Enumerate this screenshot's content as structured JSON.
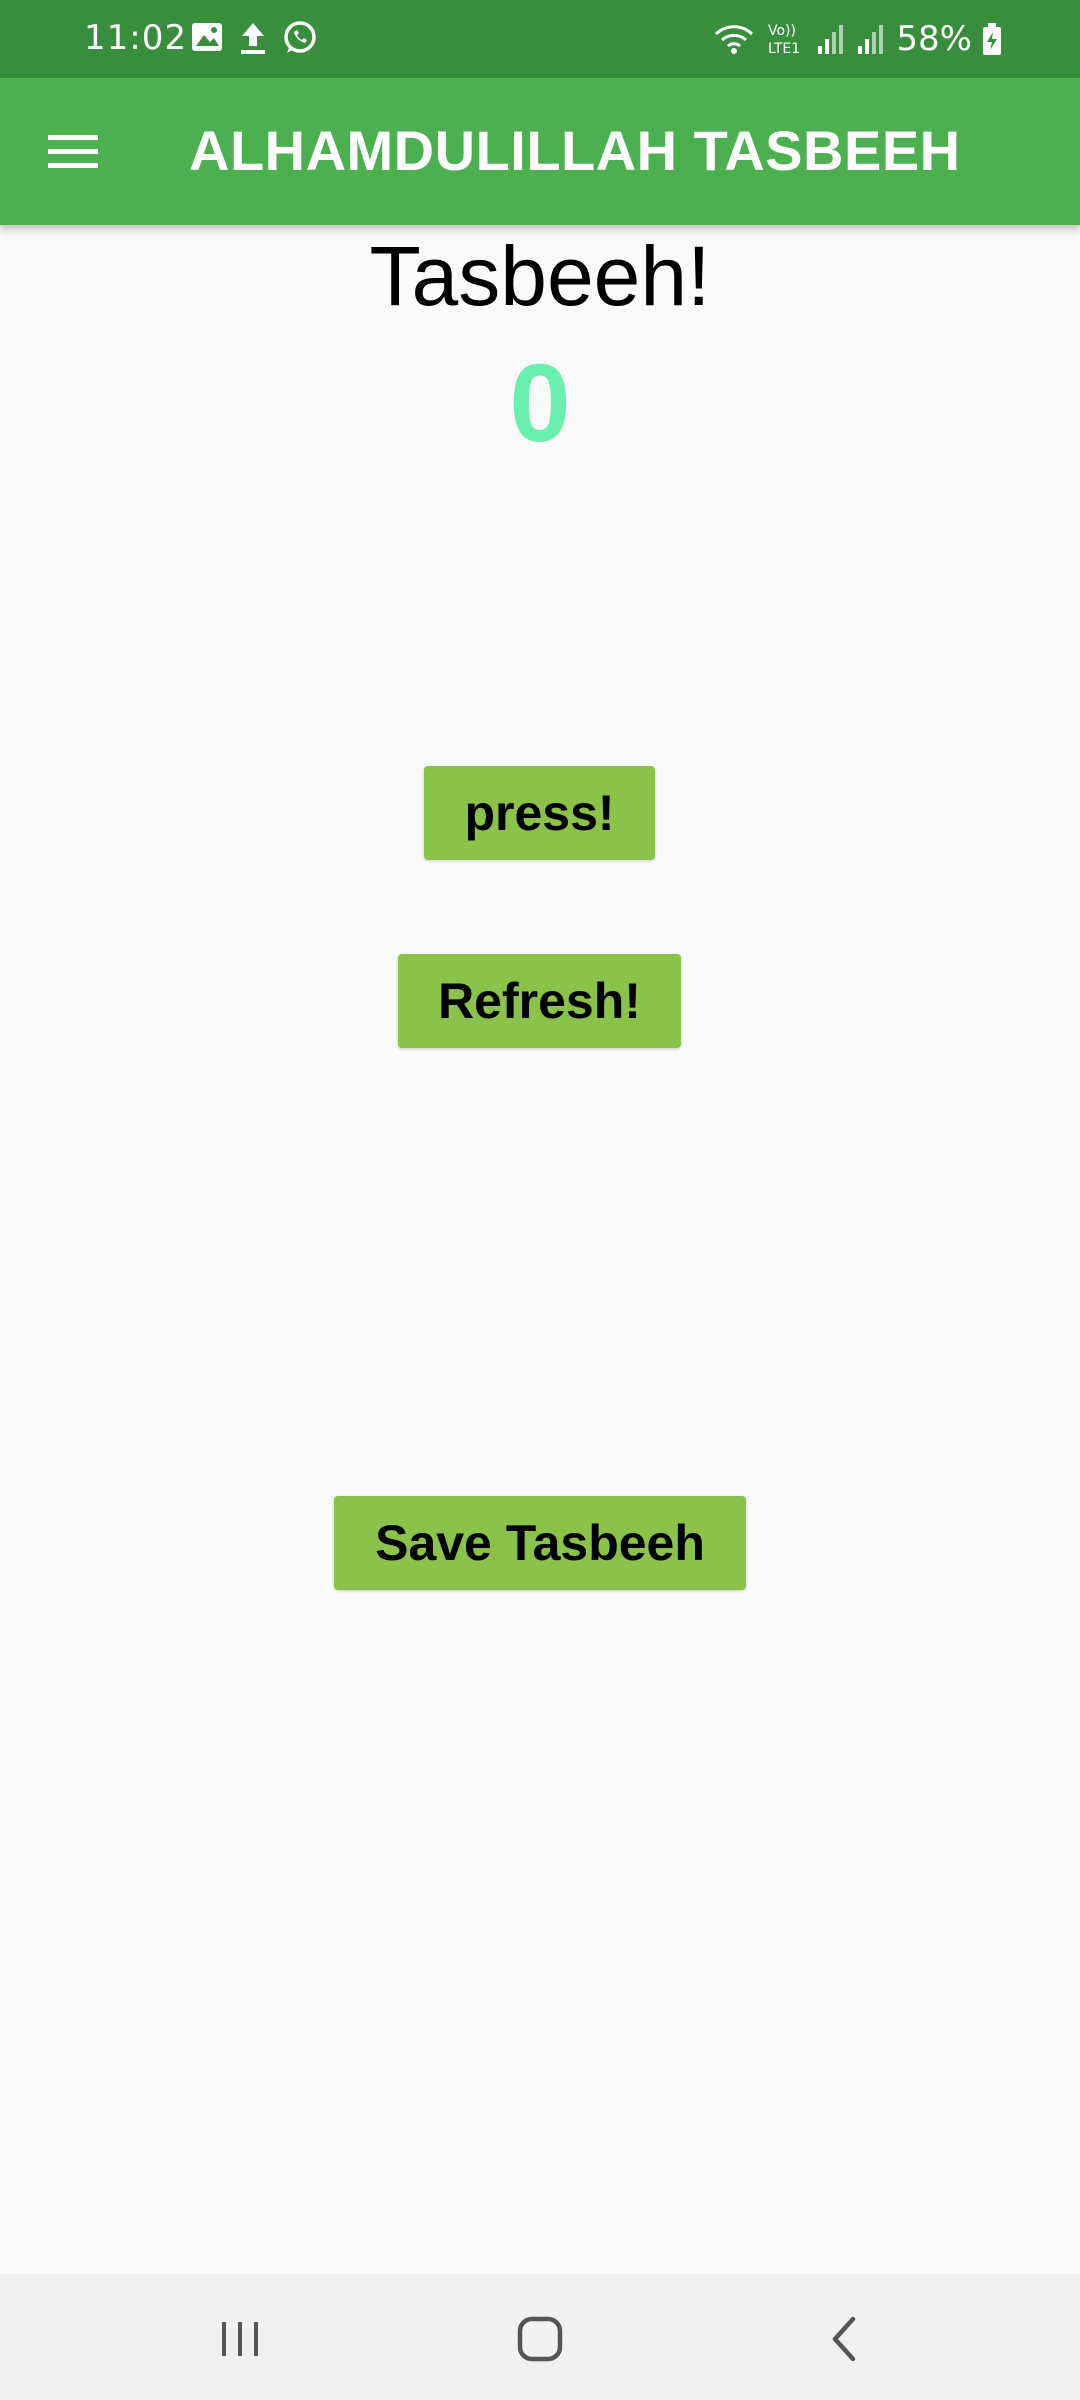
{
  "status_bar": {
    "time": "11:02",
    "battery": "58%",
    "icons_left": [
      "gallery-icon",
      "upload-icon",
      "whatsapp-icon"
    ],
    "icons_right": [
      "wifi-icon",
      "volte-icon",
      "signal-icon",
      "signal-icon",
      "battery-charging-icon"
    ]
  },
  "app_bar": {
    "title": "ALHAMDULILLAH TASBEEH",
    "menu_icon": "hamburger-menu-icon"
  },
  "main": {
    "heading": "Tasbeeh!",
    "counter": "0",
    "press_label": "press!",
    "refresh_label": "Refresh!",
    "save_label": "Save Tasbeeh"
  },
  "nav_bar": {
    "buttons": [
      "recents-icon",
      "home-icon",
      "back-icon"
    ]
  },
  "colors": {
    "status_bar": "#388e3c",
    "app_bar": "#4caf50",
    "button": "#8bc34a",
    "counter": "#69f0ae",
    "background": "#fafafa"
  }
}
